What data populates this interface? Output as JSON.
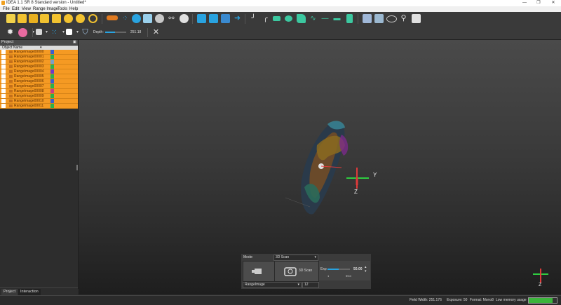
{
  "window": {
    "title": "IDEA 1.1 SR 8 Standard version - Untitled*",
    "minimize": "—",
    "maximize": "❐",
    "close": "✕"
  },
  "menu": [
    "File",
    "Edit",
    "View",
    "Range Image",
    "Tools",
    "Help"
  ],
  "toolbar2": {
    "depth_label": "Depth:",
    "depth_value": "251.18",
    "depth_fraction": 0.45
  },
  "project_panel": {
    "header": "Project",
    "column_header": "Object Name",
    "items": [
      {
        "name": "RangeImage00000",
        "color": "#3a5fd0"
      },
      {
        "name": "RangeImage00001",
        "color": "#2bb34a"
      },
      {
        "name": "RangeImage00002",
        "color": "#7aa0c8"
      },
      {
        "name": "RangeImage00003",
        "color": "#2bb34a"
      },
      {
        "name": "RangeImage00004",
        "color": "#6a3cc8"
      },
      {
        "name": "RangeImage00005",
        "color": "#2bb34a"
      },
      {
        "name": "RangeImage00006",
        "color": "#3a5fd0"
      },
      {
        "name": "RangeImage00007",
        "color": "#2bb34a"
      },
      {
        "name": "RangeImage00008",
        "color": "#c83c8a"
      },
      {
        "name": "RangeImage00009",
        "color": "#2bb34a"
      },
      {
        "name": "RangeImage00010",
        "color": "#3a5fd0"
      },
      {
        "name": "RangeImage00011",
        "color": "#2bb34a"
      }
    ],
    "tabs": [
      "Project",
      "Interaction"
    ]
  },
  "viewport": {
    "axis_y": "Y",
    "axis_z": "Z",
    "corner_z": "Z"
  },
  "mode_panel": {
    "mode_label": "Mode:",
    "mode_value": "3D Scan",
    "scan_label": "3D Scan",
    "exp_label": "Exp",
    "exp_value": "50.00",
    "exp_min": "1",
    "exp_max": "99.0",
    "exp_fraction": 0.5,
    "range_value": "RangeImage",
    "range_num": "12"
  },
  "status": {
    "field_width": "Field Width: 251.176",
    "exposure": "Exposure: 50",
    "format": "Format: Mono8",
    "memory": "Low memory usage",
    "memory_fraction": 0.85
  },
  "colors": {
    "accent": "#f59a23",
    "toolbar_icon": "#f2c230",
    "toolbar_blue": "#29a3e0"
  }
}
